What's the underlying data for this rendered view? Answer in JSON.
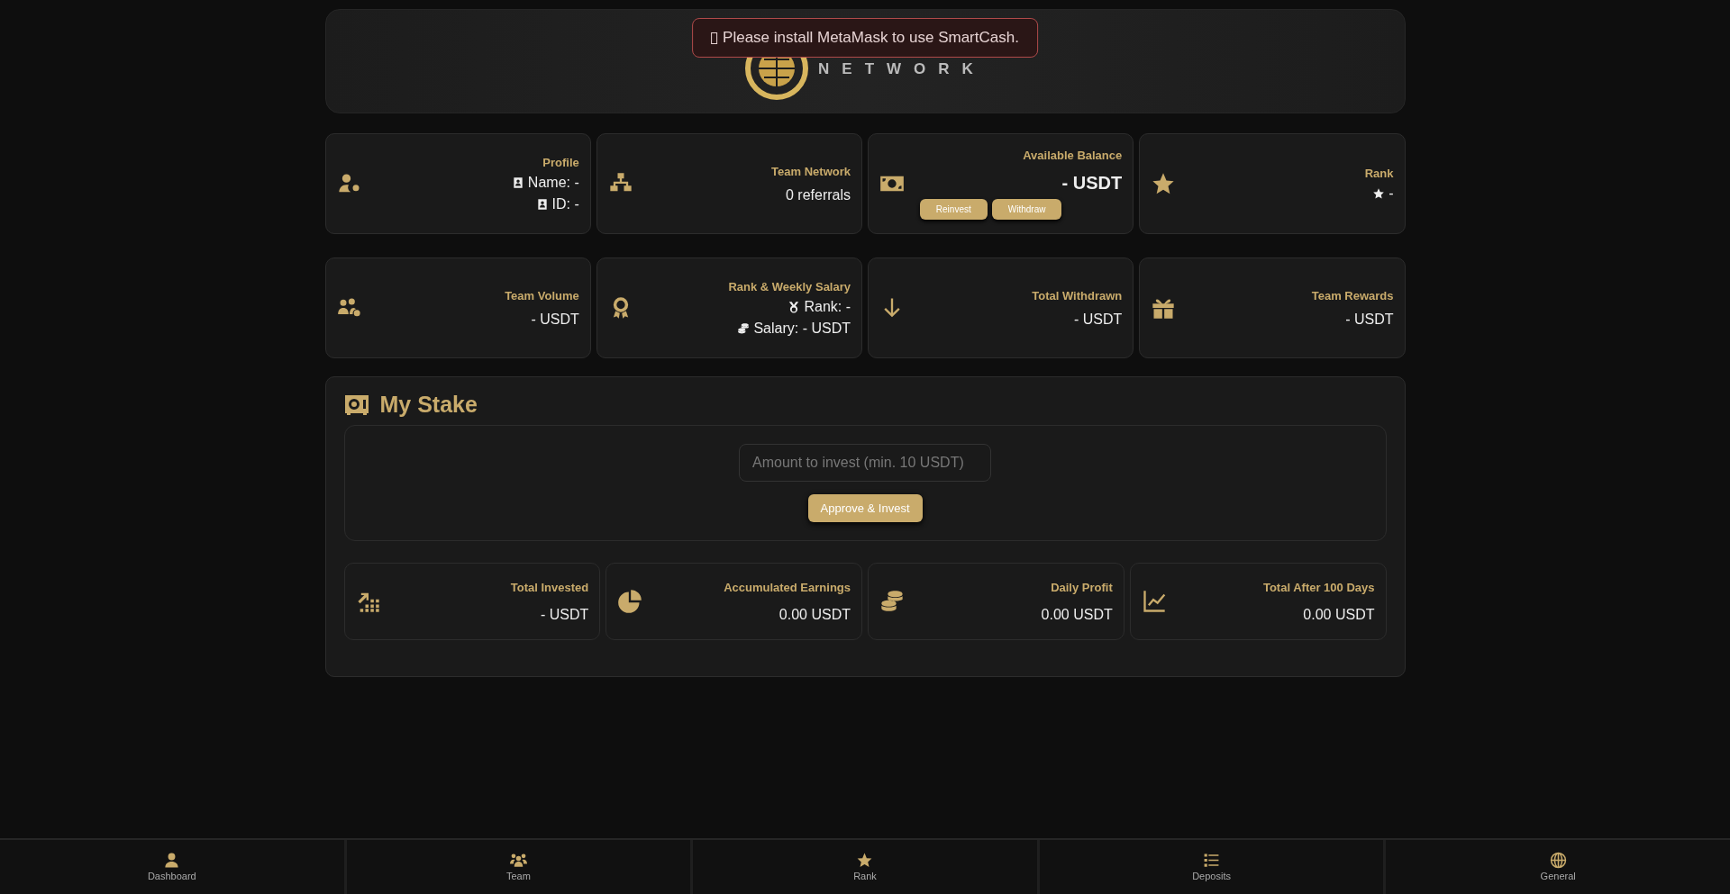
{
  "header": {
    "logo_subtitle": "NETWORK"
  },
  "toast": {
    "message": "Please install MetaMask to use SmartCash."
  },
  "cards_top": [
    {
      "title": "Profile",
      "lines": [
        "Name: -",
        "ID: -"
      ]
    },
    {
      "title": "Team Network",
      "value": "0 referrals"
    },
    {
      "title": "Available Balance",
      "value": "- USDT",
      "buttons": [
        "Reinvest",
        "Withdraw"
      ]
    },
    {
      "title": "Rank",
      "lines": [
        "-"
      ]
    }
  ],
  "cards_bottom": [
    {
      "title": "Team Volume",
      "value": "- USDT"
    },
    {
      "title": "Rank & Weekly Salary",
      "lines": [
        "Rank: -",
        "Salary: - USDT"
      ]
    },
    {
      "title": "Total Withdrawn",
      "value": "- USDT"
    },
    {
      "title": "Team Rewards",
      "value": "- USDT"
    }
  ],
  "stake": {
    "title": "My Stake",
    "amount_placeholder": "Amount to invest (min. 10 USDT)",
    "invest_button": "Approve & Invest",
    "stats": [
      {
        "title": "Total Invested",
        "value": "- USDT"
      },
      {
        "title": "Accumulated Earnings",
        "value": "0.00 USDT"
      },
      {
        "title": "Daily Profit",
        "value": "0.00 USDT"
      },
      {
        "title": "Total After 100 Days",
        "value": "0.00 USDT"
      }
    ]
  },
  "bottom_nav": [
    {
      "label": "Dashboard"
    },
    {
      "label": "Team"
    },
    {
      "label": "Rank"
    },
    {
      "label": "Deposits"
    },
    {
      "label": "General"
    }
  ]
}
